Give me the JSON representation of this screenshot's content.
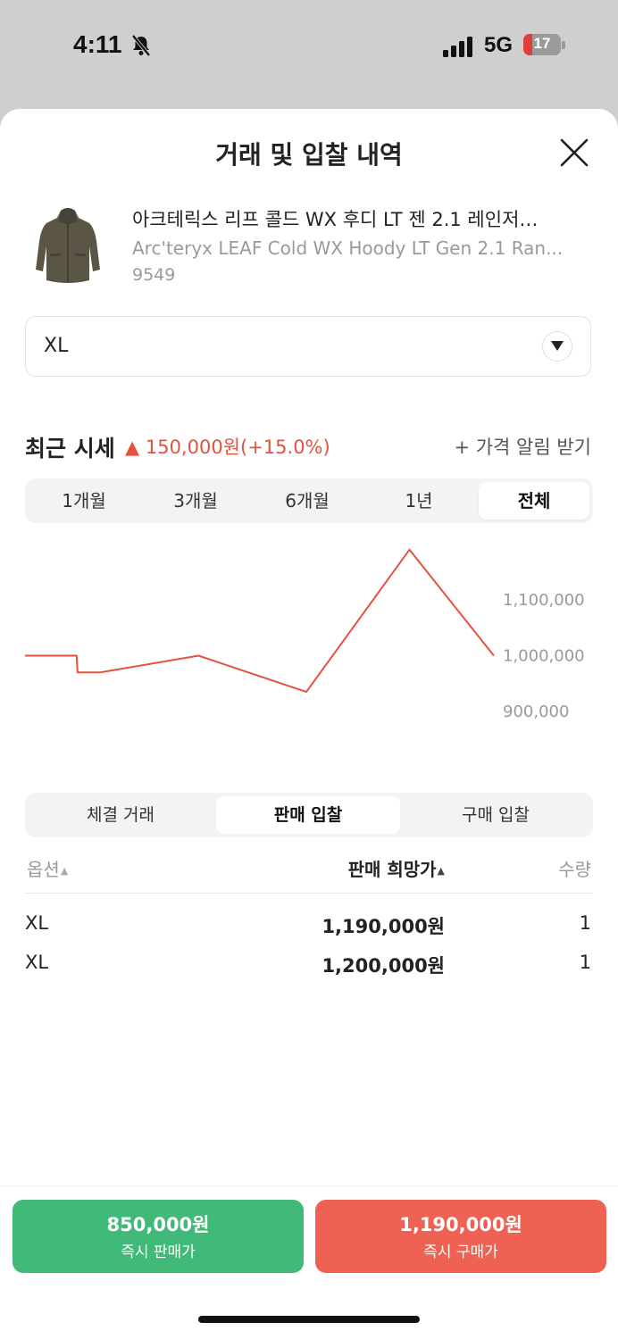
{
  "status_bar": {
    "time": "4:11",
    "network": "5G",
    "battery": "17"
  },
  "sheet": {
    "title": "거래 및 입찰 내역"
  },
  "product": {
    "name_ko": "아크테릭스 리프 콜드 WX 후디 LT 젠 2.1 레인저…",
    "name_en": "Arc'teryx LEAF Cold WX Hoody LT Gen 2.1 Ran...",
    "code": "9549"
  },
  "size_select": {
    "value": "XL"
  },
  "recent_price": {
    "title": "최근 시세",
    "change": "150,000원(+15.0%)",
    "alert_link": "+ 가격 알림 받기"
  },
  "period_tabs": [
    "1개월",
    "3개월",
    "6개월",
    "1년",
    "전체"
  ],
  "period_active": "전체",
  "chart_data": {
    "type": "line",
    "color": "#e5523f",
    "y_ticks": [
      "1,100,000",
      "1,000,000",
      "900,000"
    ],
    "ylim": [
      860000,
      1180000
    ],
    "points": [
      [
        0.0,
        1000000
      ],
      [
        0.11,
        1000000
      ],
      [
        0.112,
        970000
      ],
      [
        0.16,
        970000
      ],
      [
        0.37,
        1000000
      ],
      [
        0.6,
        935000
      ],
      [
        0.82,
        1190000
      ],
      [
        1.0,
        1000000
      ]
    ]
  },
  "trade_tabs": [
    "체결 거래",
    "판매 입찰",
    "구매 입찰"
  ],
  "trade_active": "판매 입찰",
  "table": {
    "headers": {
      "option": "옵션",
      "price": "판매 희망가",
      "qty": "수량"
    },
    "rows": [
      {
        "option": "XL",
        "price": "1,190,000원",
        "qty": "1"
      },
      {
        "option": "XL",
        "price": "1,200,000원",
        "qty": "1"
      }
    ]
  },
  "actions": {
    "sell": {
      "amount": "850,000원",
      "label": "즉시 판매가",
      "color": "#41b979"
    },
    "buy": {
      "amount": "1,190,000원",
      "label": "즉시 구매가",
      "color": "#ef6253"
    }
  }
}
